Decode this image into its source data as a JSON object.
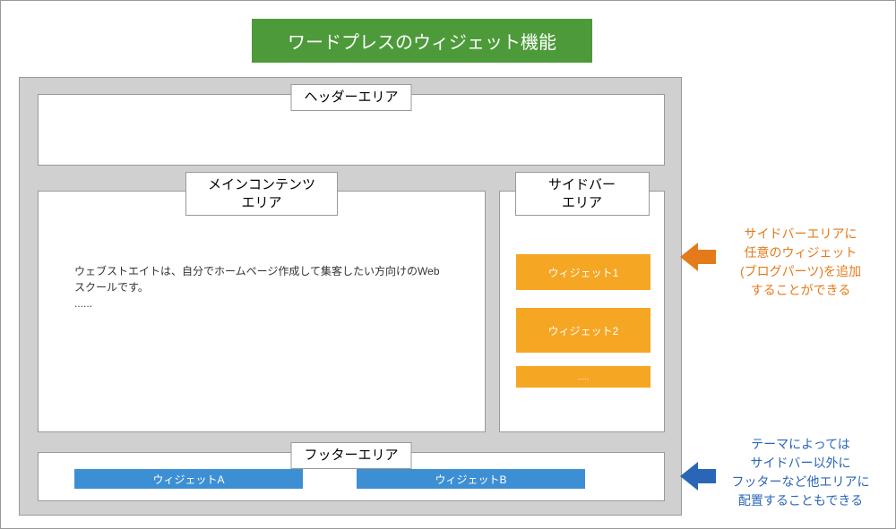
{
  "title": "ワードプレスのウィジェット機能",
  "layout": {
    "header": {
      "label": "ヘッダーエリア"
    },
    "main": {
      "label": "メインコンテンツ\nエリア",
      "body_text": "ウェブストエイトは、自分でホームページ作成して集客したい方向けのWebスクールです。",
      "body_more": "......"
    },
    "sidebar": {
      "label": "サイドバー\nエリア",
      "widgets": [
        {
          "label": "ウィジェット1"
        },
        {
          "label": "ウィジェット2"
        },
        {
          "label": "....."
        }
      ]
    },
    "footer": {
      "label": "フッターエリア",
      "widgets": [
        {
          "label": "ウィジェットA"
        },
        {
          "label": "ウィジェットB"
        }
      ]
    }
  },
  "annotations": {
    "sidebar_note": "サイドバーエリアに\n任意のウィジェット\n(ブログパーツ)を追加\nすることができる",
    "footer_note": "テーマによっては\nサイドバー以外に\nフッターなど他エリアに\n配置することもできる"
  },
  "colors": {
    "title_bg": "#4d9a3a",
    "widget_orange": "#f5a623",
    "widget_blue": "#3d8fd4",
    "arrow_orange": "#e57a1a",
    "arrow_blue": "#2a66b7"
  }
}
